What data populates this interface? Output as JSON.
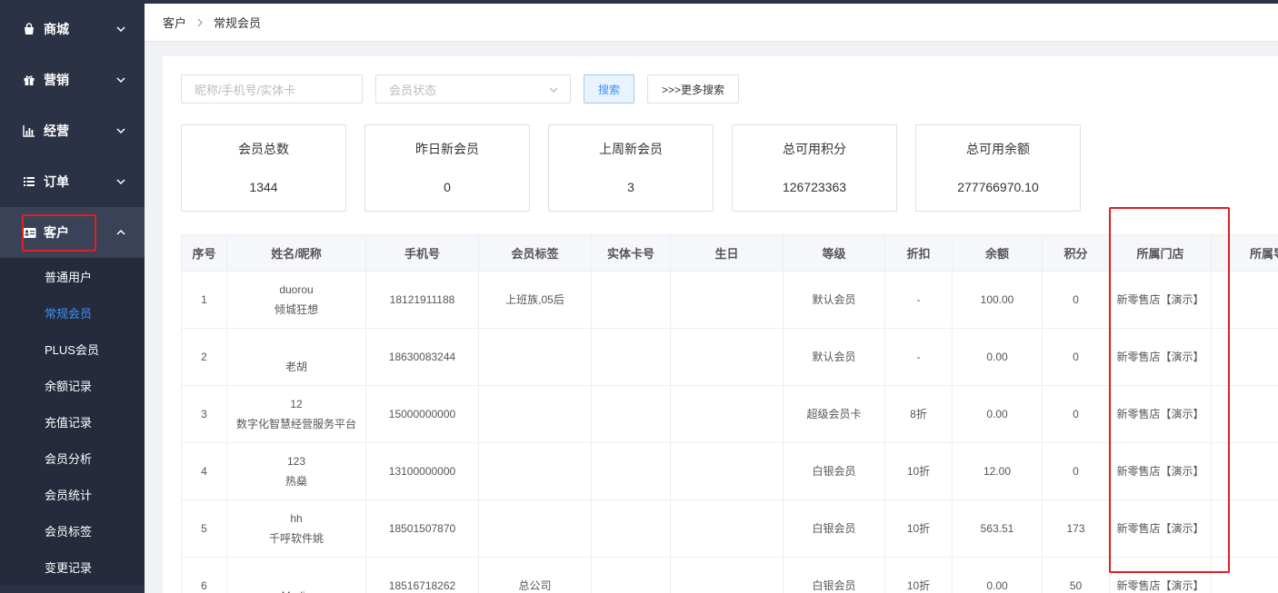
{
  "sidebar": {
    "menus": [
      {
        "label": "商城",
        "icon": "shopping-bag-icon"
      },
      {
        "label": "营销",
        "icon": "gift-icon"
      },
      {
        "label": "经营",
        "icon": "bar-chart-icon"
      },
      {
        "label": "订单",
        "icon": "list-icon"
      },
      {
        "label": "客户",
        "icon": "id-card-icon"
      }
    ],
    "sub_items": [
      "普通用户",
      "常规会员",
      "PLUS会员",
      "余额记录",
      "充值记录",
      "会员分析",
      "会员统计",
      "会员标签",
      "变更记录"
    ]
  },
  "breadcrumb": {
    "parent": "客户",
    "current": "常规会员"
  },
  "search": {
    "input_placeholder": "昵称/手机号/实体卡",
    "status_placeholder": "会员状态",
    "search_label": "搜索",
    "more_label": ">>>更多搜索"
  },
  "stats": [
    {
      "label": "会员总数",
      "value": "1344"
    },
    {
      "label": "昨日新会员",
      "value": "0"
    },
    {
      "label": "上周新会员",
      "value": "3"
    },
    {
      "label": "总可用积分",
      "value": "126723363"
    },
    {
      "label": "总可用余额",
      "value": "277766970.10"
    }
  ],
  "table": {
    "headers": [
      "序号",
      "姓名/昵称",
      "手机号",
      "会员标签",
      "实体卡号",
      "生日",
      "等级",
      "折扣",
      "余额",
      "积分",
      "所属门店",
      "所属导购"
    ],
    "rows": [
      {
        "idx": "1",
        "name1": "duorou",
        "name2": "倾城狂想",
        "phone": "18121911188",
        "tag": "上班族,05后",
        "card": "",
        "birthday": "",
        "level": "默认会员",
        "discount": "-",
        "balance": "100.00",
        "points": "0",
        "store": "新零售店【演示】",
        "guide": ""
      },
      {
        "idx": "2",
        "name1": "",
        "name2": "老胡",
        "phone": "18630083244",
        "tag": "",
        "card": "",
        "birthday": "",
        "level": "默认会员",
        "discount": "-",
        "balance": "0.00",
        "points": "0",
        "store": "新零售店【演示】",
        "guide": ""
      },
      {
        "idx": "3",
        "name1": "12",
        "name2": "数字化智慧经营服务平台",
        "phone": "15000000000",
        "tag": "",
        "card": "",
        "birthday": "",
        "level": "超级会员卡",
        "discount": "8折",
        "balance": "0.00",
        "points": "0",
        "store": "新零售店【演示】",
        "guide": ""
      },
      {
        "idx": "4",
        "name1": "123",
        "name2": "热燊",
        "phone": "13100000000",
        "tag": "",
        "card": "",
        "birthday": "",
        "level": "白银会员",
        "discount": "10折",
        "balance": "12.00",
        "points": "0",
        "store": "新零售店【演示】",
        "guide": ""
      },
      {
        "idx": "5",
        "name1": "hh",
        "name2": "千呼软件姚",
        "phone": "18501507870",
        "tag": "",
        "card": "",
        "birthday": "",
        "level": "白银会员",
        "discount": "10折",
        "balance": "563.51",
        "points": "173",
        "store": "新零售店【演示】",
        "guide": ""
      },
      {
        "idx": "6",
        "name1": "",
        "name2": "Media",
        "phone": "18516718262",
        "tag": "总公司",
        "card": "",
        "birthday": "",
        "level": "白银会员",
        "discount": "10折",
        "balance": "0.00",
        "points": "50",
        "store": "新零售店【演示】",
        "guide": ""
      }
    ]
  },
  "colors": {
    "sidebar_bg": "#2b3245",
    "accent": "#3d8ff5",
    "highlight": "#e02020"
  }
}
